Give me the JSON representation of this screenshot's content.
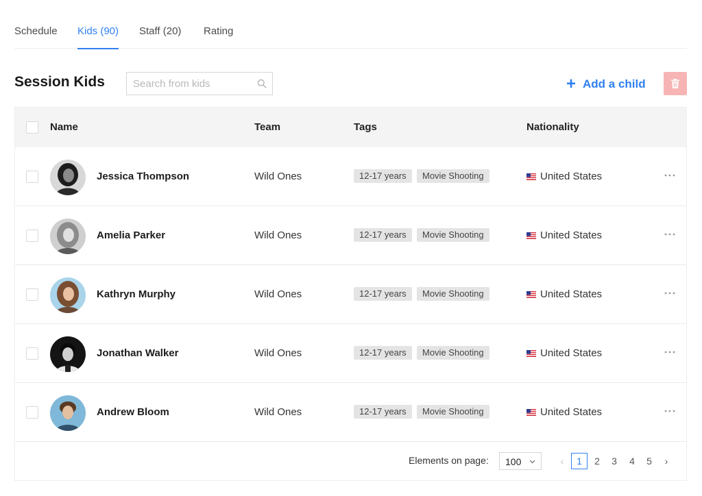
{
  "tabs": [
    {
      "label": "Schedule"
    },
    {
      "label": "Kids (90)"
    },
    {
      "label": "Staff (20)"
    },
    {
      "label": "Rating"
    }
  ],
  "active_tab": "Kids (90)",
  "page_title": "Session Kids",
  "search": {
    "placeholder": "Search from kids",
    "icon": "search-icon"
  },
  "add_child": {
    "label": "Add a child",
    "icon": "plus-icon"
  },
  "delete_button": {
    "icon": "trash-icon"
  },
  "table": {
    "columns": {
      "name": "Name",
      "team": "Team",
      "tags": "Tags",
      "nationality": "Nationality"
    },
    "rows": [
      {
        "name": "Jessica Thompson",
        "team": "Wild Ones",
        "tags": [
          "12-17 years",
          "Movie Shooting"
        ],
        "nationality": "United States",
        "flag": "us-flag-icon"
      },
      {
        "name": "Amelia Parker",
        "team": "Wild Ones",
        "tags": [
          "12-17 years",
          "Movie Shooting"
        ],
        "nationality": "United States",
        "flag": "us-flag-icon"
      },
      {
        "name": "Kathryn Murphy",
        "team": "Wild Ones",
        "tags": [
          "12-17 years",
          "Movie Shooting"
        ],
        "nationality": "United States",
        "flag": "us-flag-icon"
      },
      {
        "name": "Jonathan Walker",
        "team": "Wild Ones",
        "tags": [
          "12-17 years",
          "Movie Shooting"
        ],
        "nationality": "United States",
        "flag": "us-flag-icon"
      },
      {
        "name": "Andrew Bloom",
        "team": "Wild Ones",
        "tags": [
          "12-17 years",
          "Movie Shooting"
        ],
        "nationality": "United States",
        "flag": "us-flag-icon"
      }
    ]
  },
  "footer": {
    "elements_label": "Elements on page:",
    "page_size": "100",
    "pages": [
      "1",
      "2",
      "3",
      "4",
      "5"
    ],
    "current_page": "1",
    "prev_label": "‹",
    "next_label": "›"
  },
  "colors": {
    "accent": "#2f7ff0",
    "delete_bg": "#f6b4b4",
    "header_bg": "#f4f4f4",
    "tag_bg": "#e4e4e4"
  }
}
